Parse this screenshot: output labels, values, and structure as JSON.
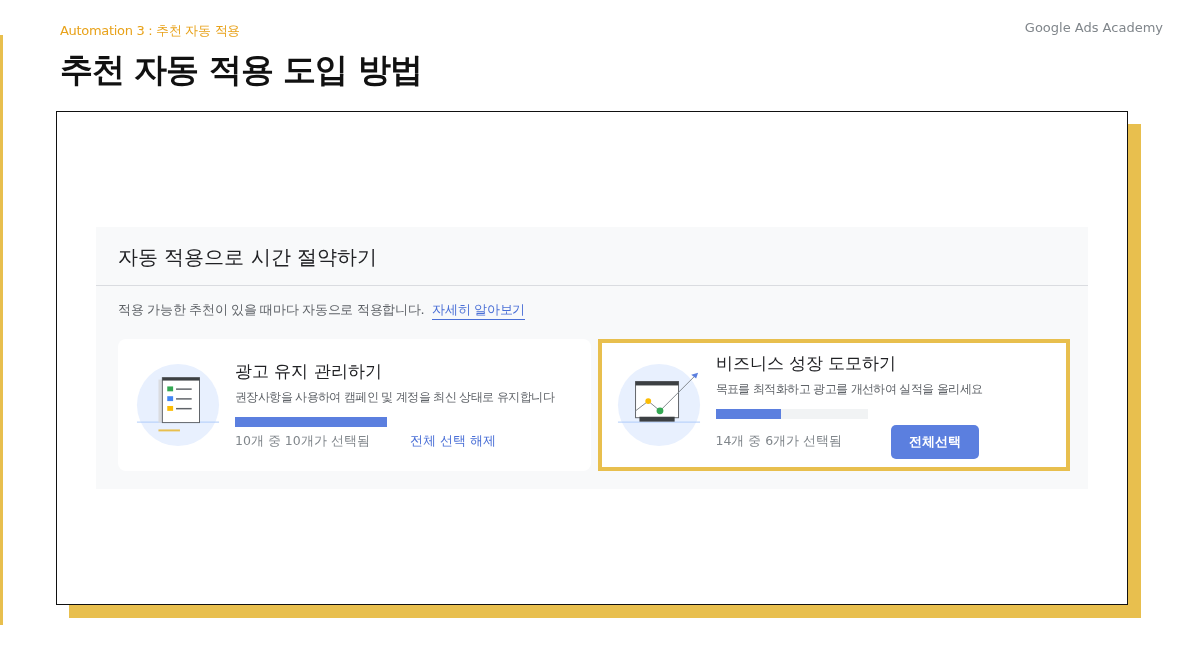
{
  "slide": {
    "subtitle": "Automation 3 : 추천 자동 적용",
    "title": "추천 자동 적용 도입 방법",
    "brand": "Google Ads Academy"
  },
  "panel": {
    "heading": "자동 적용으로 시간 절약하기",
    "description": "적용 가능한 추천이 있을 때마다 자동으로 적용합니다.",
    "link": "자세히 알아보기",
    "cards": [
      {
        "kind": "checklist",
        "highlighted": false,
        "title": "광고 유지 관리하기",
        "description": "권장사항을 사용하여 캠페인 및 계정을 최신 상태로 유지합니다",
        "level": 1,
        "count": "10개 중 10개가 선택됨",
        "action": {
          "kind": "link",
          "label": "전체 선택 해제"
        }
      },
      {
        "kind": "chart",
        "highlighted": true,
        "title": "비즈니스 성장 도모하기",
        "description": "목표를 최적화하고 광고를 개선하여 실적을 올리세요",
        "level": 0.43,
        "count": "14개 중 6개가 선택됨",
        "action": {
          "kind": "button",
          "label": "전체선택"
        }
      }
    ]
  }
}
